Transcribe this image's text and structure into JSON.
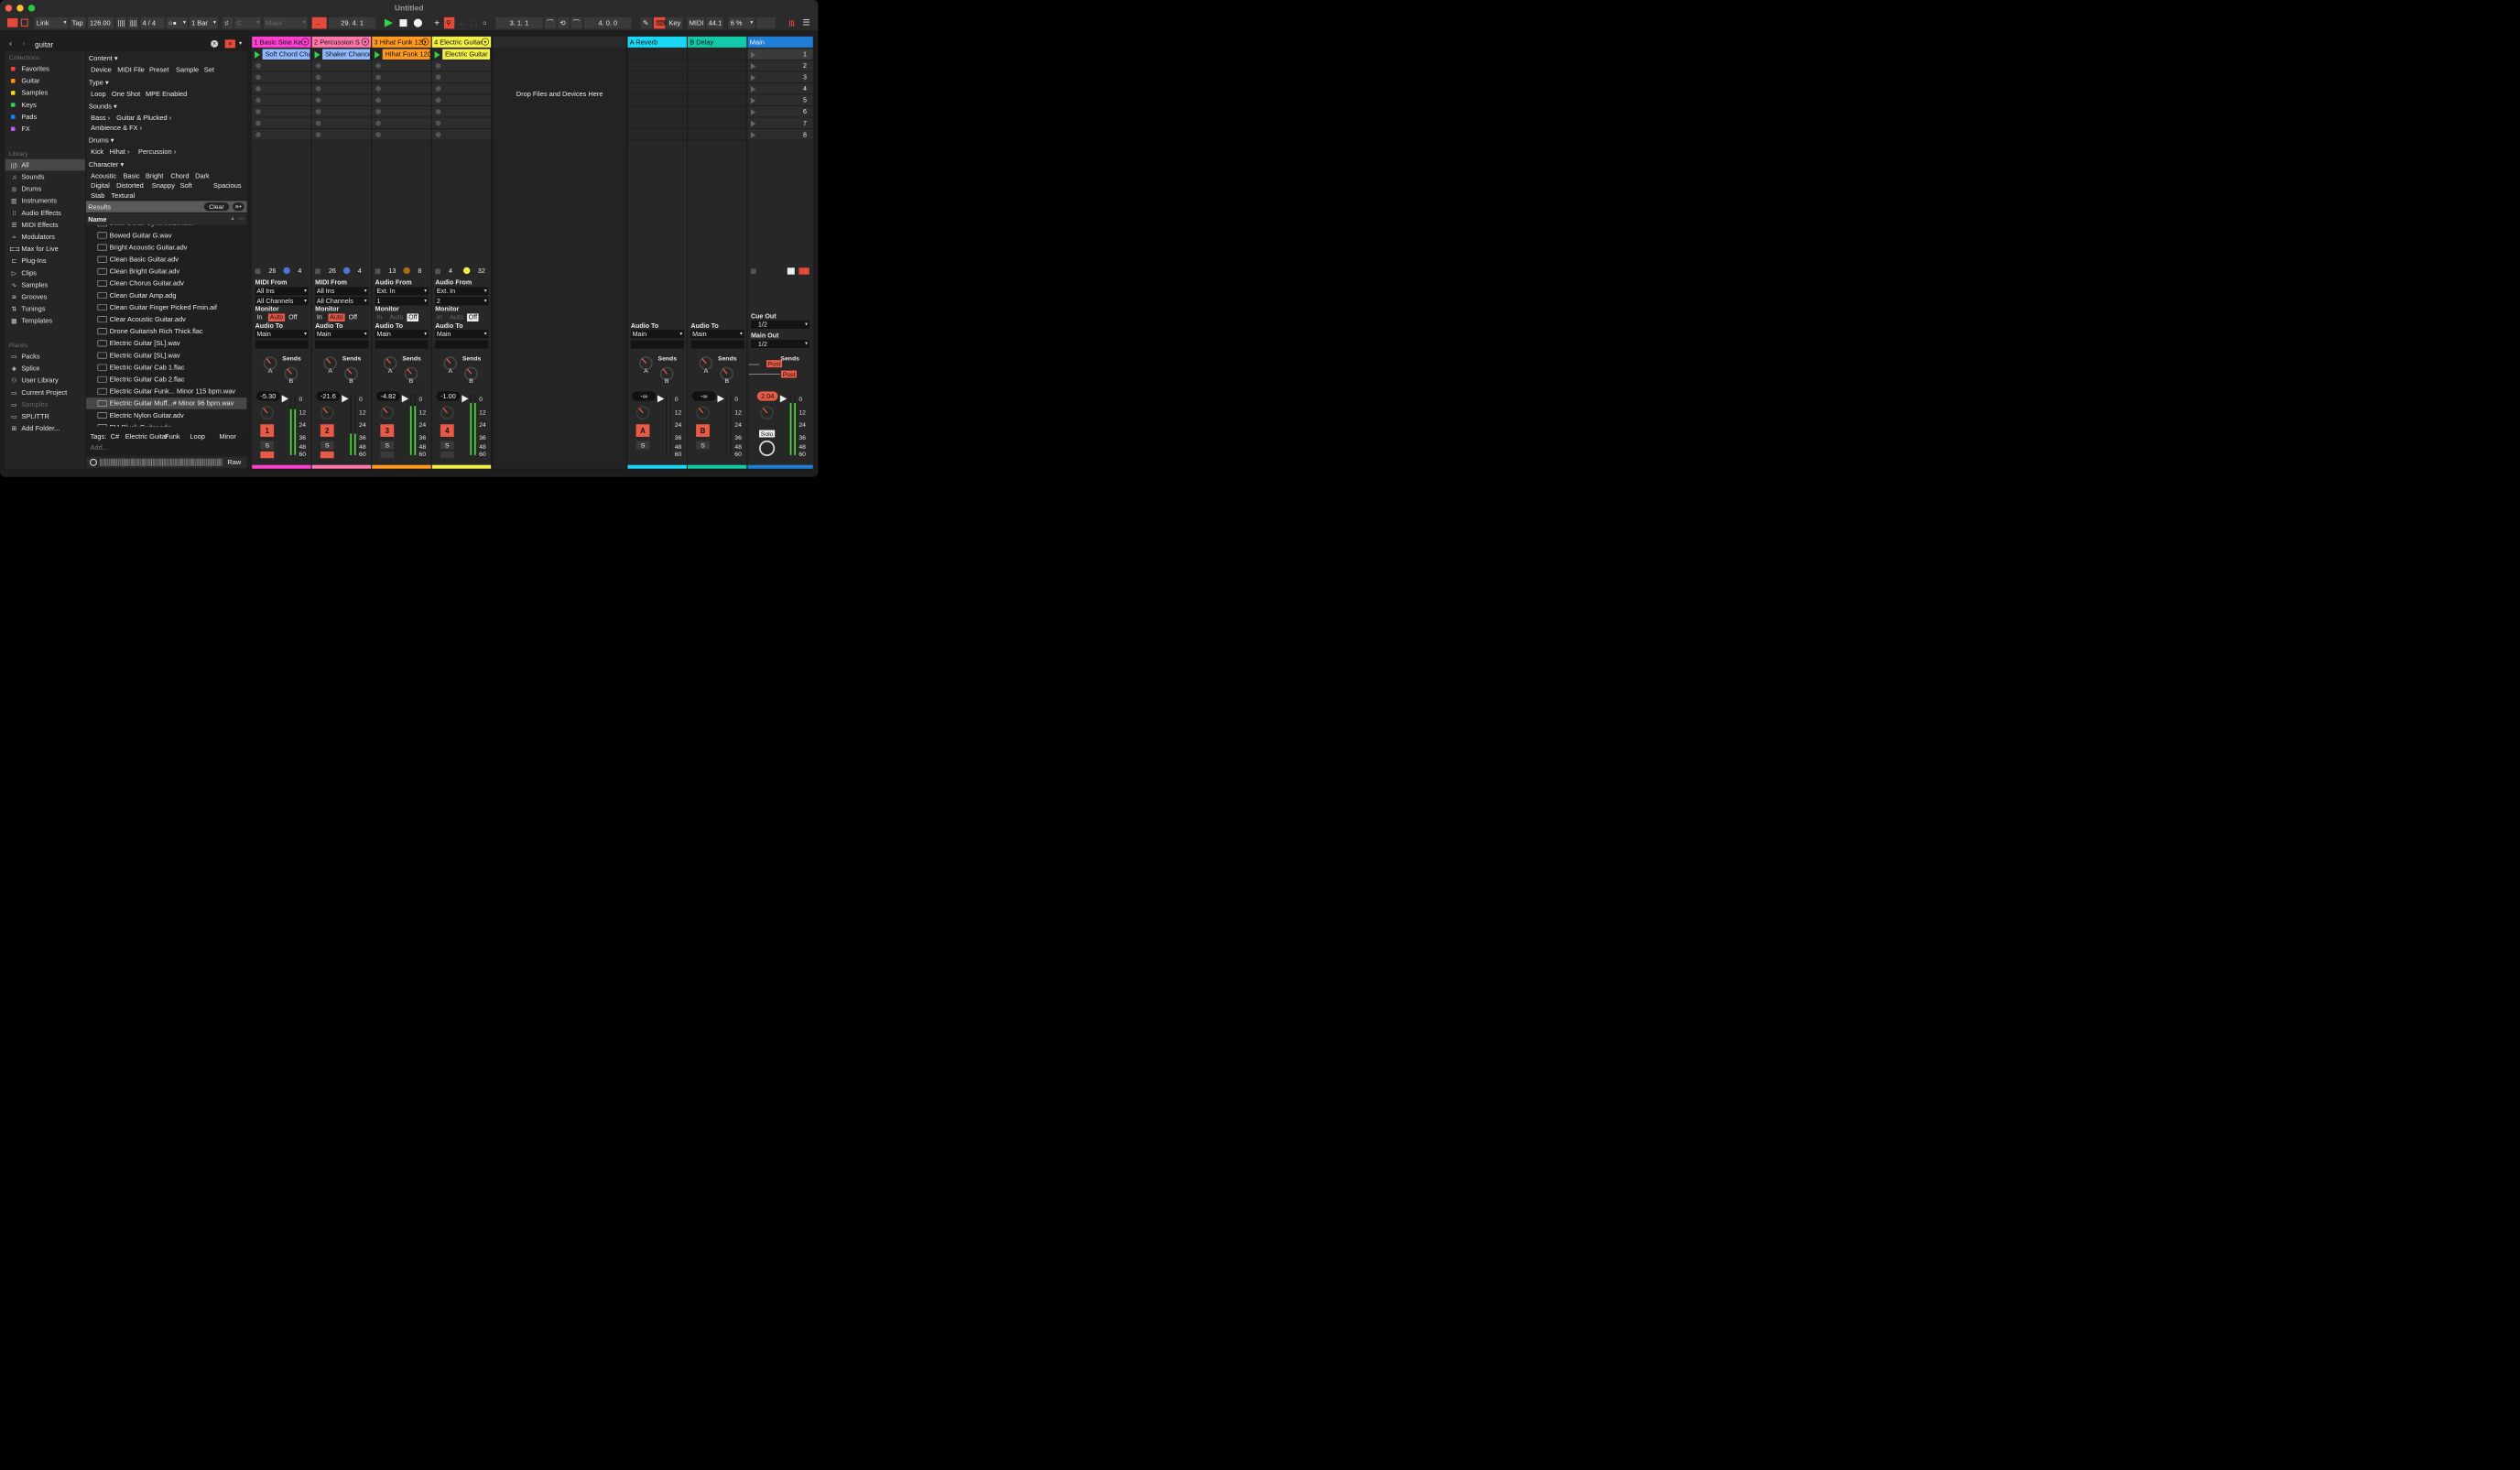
{
  "window": {
    "title": "Untitled"
  },
  "controlbar": {
    "link": "Link",
    "tap": "Tap",
    "tempo": "126.00",
    "meter": "4 / 4",
    "quantize": "1 Bar",
    "key_root": "C",
    "scale": "Major",
    "position": "29.   4.   1",
    "loop_start": "3.   1.   1",
    "loop_length": "4.   0.   0",
    "key_label": "Key",
    "midi_label": "MIDI",
    "sample_rate": "44.1",
    "cpu": "6 %"
  },
  "browser": {
    "search": "guitar",
    "collections_header": "Collections",
    "collections": [
      {
        "label": "Favorites",
        "color": "#ff3b30"
      },
      {
        "label": "Guitar",
        "color": "#ff9500"
      },
      {
        "label": "Samples",
        "color": "#ffd60a"
      },
      {
        "label": "Keys",
        "color": "#30d158"
      },
      {
        "label": "Pads",
        "color": "#0a84ff"
      },
      {
        "label": "FX",
        "color": "#bf5af2"
      }
    ],
    "library_header": "Library",
    "library": [
      {
        "label": "All",
        "icon": "bars-icon"
      },
      {
        "label": "Sounds",
        "icon": "note-icon"
      },
      {
        "label": "Drums",
        "icon": "drum-icon"
      },
      {
        "label": "Instruments",
        "icon": "keyboard-icon"
      },
      {
        "label": "Audio Effects",
        "icon": "audio-fx-icon"
      },
      {
        "label": "MIDI Effects",
        "icon": "midi-fx-icon"
      },
      {
        "label": "Modulators",
        "icon": "modulator-icon"
      },
      {
        "label": "Max for Live",
        "icon": "max-icon"
      },
      {
        "label": "Plug-Ins",
        "icon": "plugin-icon"
      },
      {
        "label": "Clips",
        "icon": "clip-icon"
      },
      {
        "label": "Samples",
        "icon": "waveform-icon"
      },
      {
        "label": "Grooves",
        "icon": "groove-icon"
      },
      {
        "label": "Tunings",
        "icon": "tuning-icon"
      },
      {
        "label": "Templates",
        "icon": "template-icon"
      }
    ],
    "places_header": "Places",
    "places": [
      {
        "label": "Packs",
        "icon": "packs-icon"
      },
      {
        "label": "Splice",
        "icon": "splice-icon"
      },
      {
        "label": "User Library",
        "icon": "user-icon"
      },
      {
        "label": "Current Project",
        "icon": "project-icon"
      },
      {
        "label": "Samples",
        "icon": "folder-icon"
      },
      {
        "label": "SPLITTR",
        "icon": "folder-icon"
      },
      {
        "label": "Add Folder...",
        "icon": "add-folder-icon"
      }
    ],
    "filters": {
      "content": "Content",
      "content_tags": [
        "Device",
        "MIDI File",
        "Preset",
        "Sample",
        "Set"
      ],
      "type": "Type",
      "type_tags": [
        "Loop",
        "One Shot",
        "MPE Enabled"
      ],
      "sounds": "Sounds",
      "sounds_tags": [
        "Bass",
        "Guitar & Plucked",
        "Ambience & FX"
      ],
      "drums": "Drums",
      "drums_tags": [
        "Kick",
        "Hihat",
        "Percussion"
      ],
      "character": "Character",
      "character_tags": [
        "Acoustic",
        "Basic",
        "Bright",
        "Chord",
        "Dark",
        "Digital",
        "Distorted",
        "Snappy",
        "Soft",
        "Spacious",
        "Stab",
        "Textural"
      ]
    },
    "results_label": "Results",
    "clear": "Clear",
    "name_col": "Name",
    "files": [
      "Bass Guitar Synthesizer.adv",
      "Bowed Guitar G.wav",
      "Bright Acoustic Guitar.adv",
      "Clean Basic Guitar.adv",
      "Clean Bright Guitar.adv",
      "Clean Chorus Guitar.adv",
      "Clean Guitar Amp.adg",
      "Clean Guitar Finger Picked Fmin.aif",
      "Clear Acoustic Guitar.adv",
      "Drone Guitarish Rich Thick.flac",
      "Electric Guitar [SL].wav",
      "Electric Guitar [SL].wav",
      "Electric Guitar Cab 1.flac",
      "Electric Guitar Cab 2.flac",
      "Electric Guitar Funk... Minor 115 bpm.wav",
      "Electric Guitar Muff...# Minor 96 bpm.wav",
      "Electric Nylon Guitar.adv",
      "FM Pluck Guitar.adg"
    ],
    "tags_label": "Tags:",
    "tags": [
      "C#",
      "Electric Guitar",
      "Funk",
      "Loop",
      "Minor"
    ],
    "add_label": "Add...",
    "raw_label": "Raw"
  },
  "session": {
    "drop_text": "Drop Files and Devices Here",
    "tracks": [
      {
        "name": "1 Basic Sine Ke",
        "color": "#ff3fd0",
        "clip": "Soft Chord Cha",
        "clip_color": "#8fb8ff",
        "n1": "26",
        "n2": "4",
        "knob_color": "#4f74d6",
        "io_from": "MIDI From",
        "from1": "All Ins",
        "from2": "All Channels",
        "monitor": "Monitor",
        "mon_active": "Auto",
        "audio_to": "Audio To",
        "to": "Main",
        "sends": "Sends",
        "vol": "-5.30",
        "num": "1",
        "solo": "S",
        "level": 0.75
      },
      {
        "name": "2 Percussion S",
        "color": "#ff77aa",
        "clip": "Shaker Chance",
        "clip_color": "#8fb8ff",
        "n1": "26",
        "n2": "4",
        "knob_color": "#4f74d6",
        "io_from": "MIDI From",
        "from1": "All Ins",
        "from2": "All Channels",
        "monitor": "Monitor",
        "mon_active": "Auto",
        "audio_to": "Audio To",
        "to": "Main",
        "sends": "Sends",
        "vol": "-21.6",
        "num": "2",
        "solo": "S",
        "level": 0.35
      },
      {
        "name": "3 Hihat Funk 120",
        "color": "#ff9a1f",
        "clip": "Hihat Funk 120",
        "clip_color": "#ff9a1f",
        "n1": "13",
        "n2": "8",
        "knob_color": "#a86b12",
        "io_from": "Audio From",
        "from1": "Ext. In",
        "from2": "1",
        "monitor": "Monitor",
        "mon_active": "Off",
        "audio_to": "Audio To",
        "to": "Main",
        "sends": "Sends",
        "vol": "-4.82",
        "num": "3",
        "solo": "S",
        "level": 0.8
      },
      {
        "name": "4 Electric Guitar",
        "color": "#f2ef47",
        "clip": "Electric Guitar",
        "clip_color": "#f2ef47",
        "n1": "4",
        "n2": "32",
        "knob_color": "#f2ef47",
        "io_from": "Audio From",
        "from1": "Ext. In",
        "from2": "2",
        "monitor": "Monitor",
        "mon_active": "Off",
        "audio_to": "Audio To",
        "to": "Main",
        "sends": "Sends",
        "vol": "-1.00",
        "num": "4",
        "solo": "S",
        "level": 0.85
      }
    ],
    "returns": [
      {
        "name": "A Reverb",
        "color": "#19d7f5",
        "audio_to": "Audio To",
        "to": "Main",
        "sends": "Sends",
        "vol": "-∞",
        "num": "A",
        "solo": "S"
      },
      {
        "name": "B Delay",
        "color": "#12c9a8",
        "audio_to": "Audio To",
        "to": "Main",
        "sends": "Sends",
        "vol": "-∞",
        "num": "B",
        "solo": "S"
      }
    ],
    "main": {
      "name": "Main",
      "color": "#1f7fd6",
      "scenes": [
        "1",
        "2",
        "3",
        "4",
        "5",
        "6",
        "7",
        "8"
      ],
      "cue_out": "Cue Out",
      "cue_val": "1/2",
      "main_out": "Main Out",
      "main_val": "1/2",
      "sends": "Sends",
      "post": "Post",
      "vol": "2.04",
      "solo": "Solo",
      "level": 0.85
    },
    "send_labels": [
      "A",
      "B"
    ],
    "scale": [
      "0",
      "12",
      "24",
      "36",
      "48",
      "60"
    ]
  }
}
